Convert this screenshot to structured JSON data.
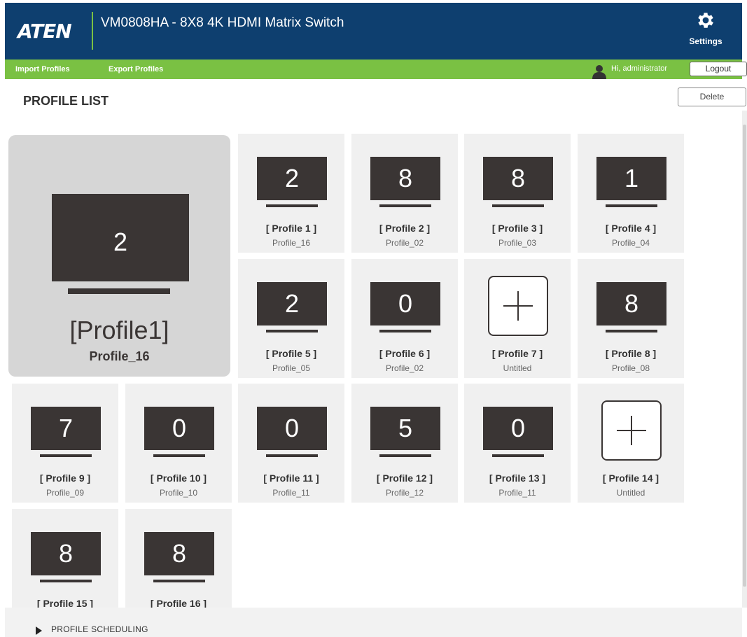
{
  "header": {
    "logo": "ATEN",
    "title": "VM0808HA - 8X8 4K HDMI Matrix Switch",
    "settings_label": "Settings",
    "settings_icon": "gear-icon"
  },
  "toolbar": {
    "import_label": "Import Profiles",
    "export_label": "Export Profiles",
    "user_icon": "user-icon",
    "greeting": "Hi, administrator",
    "logout_label": "Logout"
  },
  "page": {
    "title": "PROFILE LIST",
    "delete_label": "Delete"
  },
  "active_profile": {
    "number": "2",
    "name": "[Profile1]",
    "subtitle": "Profile_16"
  },
  "profiles": [
    {
      "number": "2",
      "name": "[ Profile 1 ]",
      "subtitle": "Profile_16"
    },
    {
      "number": "8",
      "name": "[ Profile 2 ]",
      "subtitle": "Profile_02"
    },
    {
      "number": "8",
      "name": "[ Profile 3 ]",
      "subtitle": "Profile_03"
    },
    {
      "number": "1",
      "name": "[ Profile 4 ]",
      "subtitle": "Profile_04"
    },
    {
      "number": "2",
      "name": "[ Profile 5 ]",
      "subtitle": "Profile_05"
    },
    {
      "number": "0",
      "name": "[ Profile 6 ]",
      "subtitle": "Profile_02"
    },
    {
      "number": "",
      "name": "[ Profile 7 ]",
      "subtitle": "Untitled",
      "empty": true
    },
    {
      "number": "8",
      "name": "[ Profile 8 ]",
      "subtitle": "Profile_08"
    },
    {
      "number": "7",
      "name": "[ Profile 9 ]",
      "subtitle": "Profile_09"
    },
    {
      "number": "0",
      "name": "[ Profile 10 ]",
      "subtitle": "Profile_10"
    },
    {
      "number": "0",
      "name": "[ Profile 11 ]",
      "subtitle": "Profile_11"
    },
    {
      "number": "5",
      "name": "[ Profile 12 ]",
      "subtitle": "Profile_12"
    },
    {
      "number": "0",
      "name": "[ Profile 13 ]",
      "subtitle": "Profile_11"
    },
    {
      "number": "",
      "name": "[ Profile 14 ]",
      "subtitle": "Untitled",
      "empty": true
    },
    {
      "number": "8",
      "name": "[ Profile 15 ]",
      "subtitle": ""
    },
    {
      "number": "8",
      "name": "[ Profile 16 ]",
      "subtitle": ""
    }
  ],
  "scheduling": {
    "label": "PROFILE SCHEDULING",
    "arrow_icon": "triangle-right-icon"
  }
}
